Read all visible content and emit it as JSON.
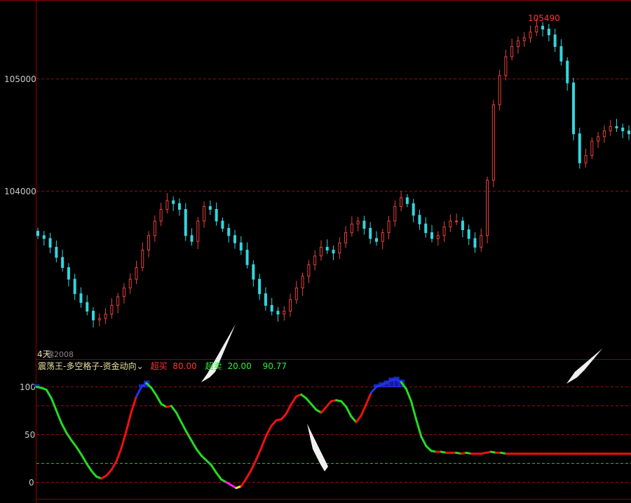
{
  "colors": {
    "background": "#000000",
    "frame": "#8b0000",
    "grid_red": "#8b1010",
    "grid_green": "#1fbf1f",
    "candle_up": "#e8413c",
    "candle_down": "#33d6e0",
    "osc_up": "#ee1111",
    "osc_down": "#22dd22",
    "osc_low": "#ee22ee",
    "osc_turn": "#eeee22",
    "osc_top": "#2233ee",
    "axis_text": "#c8c8c8",
    "title_text": "#e8e0a0",
    "label_red": "#ff3333",
    "label_green": "#33ee33"
  },
  "price_panel": {
    "y_ticks": [
      "105000",
      "104000"
    ],
    "max_label": "105490"
  },
  "indicator_panel": {
    "period_label": "4天",
    "overlay_label": "锦2008",
    "title": "震荡王-多空格子-资金动向",
    "dropdown_icon": "chevron-down-icon",
    "overbought_label": "超买",
    "overbought_value": "80.00",
    "oversold_label": "超卖",
    "oversold_value": "20.00",
    "current_value": "90.77",
    "y_ticks": [
      "100",
      "50",
      "0"
    ]
  },
  "chart_data": [
    {
      "type": "candlestick",
      "title": "",
      "y_ticks": [
        105000,
        104000
      ],
      "ylim": [
        103150,
        105620
      ],
      "max_annotation": 105490,
      "series": [
        {
          "values_close": [
            104000,
            103980,
            103920,
            103850,
            103780,
            103700,
            103600,
            103540,
            103480,
            103420,
            103430,
            103460,
            103520,
            103580,
            103640,
            103700,
            103780,
            103900,
            104000,
            104100,
            104180,
            104240,
            104220,
            104180,
            104000,
            103960,
            104100,
            104200,
            104180,
            104100,
            104050,
            104000,
            103950,
            103900,
            103800,
            103700,
            103600,
            103520,
            103480,
            103460,
            103480,
            103560,
            103640,
            103720,
            103800,
            103860,
            103920,
            103900,
            103880,
            103950,
            104020,
            104080,
            104100,
            104050,
            103980,
            103960,
            104020,
            104100,
            104200,
            104260,
            104220,
            104140,
            104080,
            104020,
            103980,
            104000,
            104060,
            104100,
            104100,
            104040,
            103980,
            103920,
            104000,
            104380,
            104900,
            105100,
            105230,
            105300,
            105340,
            105360,
            105400,
            105440,
            105420,
            105380,
            105300,
            105200,
            105050,
            104700,
            104500,
            104550,
            104650,
            104680,
            104720,
            104750,
            104740,
            104720,
            104700
          ]
        }
      ]
    },
    {
      "type": "line",
      "title": "震荡王-多空格子-资金动向",
      "y_ticks": [
        100,
        50,
        0
      ],
      "ylim": [
        -8,
        120
      ],
      "reference_lines": [
        80,
        20
      ],
      "x": [
        0,
        1,
        2,
        3,
        4,
        5,
        6,
        7,
        8,
        9,
        10,
        11,
        12,
        13,
        14,
        15,
        16,
        17,
        18,
        19,
        20,
        21,
        22,
        23,
        24,
        25,
        26,
        27,
        28,
        29,
        30,
        31,
        32,
        33,
        34,
        35,
        36,
        37,
        38,
        39,
        40,
        41,
        42,
        43,
        44,
        45,
        46,
        47,
        48,
        49,
        50,
        51,
        52,
        53,
        54,
        55,
        56,
        57,
        58,
        59,
        60,
        61,
        62,
        63,
        64,
        65,
        66,
        67,
        68,
        69,
        70,
        71,
        72,
        73,
        74,
        75,
        76,
        77,
        78,
        79,
        80,
        81,
        82,
        83,
        84,
        85,
        86,
        87,
        88,
        89,
        90,
        91,
        92,
        93,
        94,
        95,
        96,
        97,
        98,
        99,
        100,
        101,
        102,
        103,
        104,
        105,
        106,
        107,
        108,
        109,
        110,
        111,
        112,
        113,
        114,
        115,
        116,
        117,
        118,
        119
      ],
      "values": [
        100,
        99,
        97,
        88,
        75,
        62,
        52,
        44,
        37,
        29,
        20,
        12,
        6,
        4,
        7,
        13,
        22,
        36,
        54,
        74,
        90,
        100,
        104,
        99,
        91,
        82,
        79,
        80,
        73,
        63,
        53,
        44,
        35,
        28,
        23,
        18,
        10,
        3,
        0,
        -3,
        -6,
        -4,
        4,
        13,
        24,
        36,
        49,
        59,
        65,
        66,
        72,
        82,
        90,
        92,
        88,
        82,
        76,
        73,
        79,
        85,
        86,
        85,
        79,
        69,
        63,
        70,
        82,
        94,
        100,
        102,
        104,
        107,
        108,
        105,
        98,
        85,
        66,
        48,
        38,
        33,
        32,
        32,
        31,
        31,
        31,
        30,
        31,
        30,
        30,
        30,
        31,
        32,
        31,
        31,
        30,
        30,
        30,
        30,
        30,
        30,
        30,
        30,
        30,
        30,
        30,
        30,
        30,
        30,
        30,
        30,
        30,
        30,
        30,
        30,
        30,
        30,
        30,
        30,
        30,
        30
      ]
    }
  ]
}
